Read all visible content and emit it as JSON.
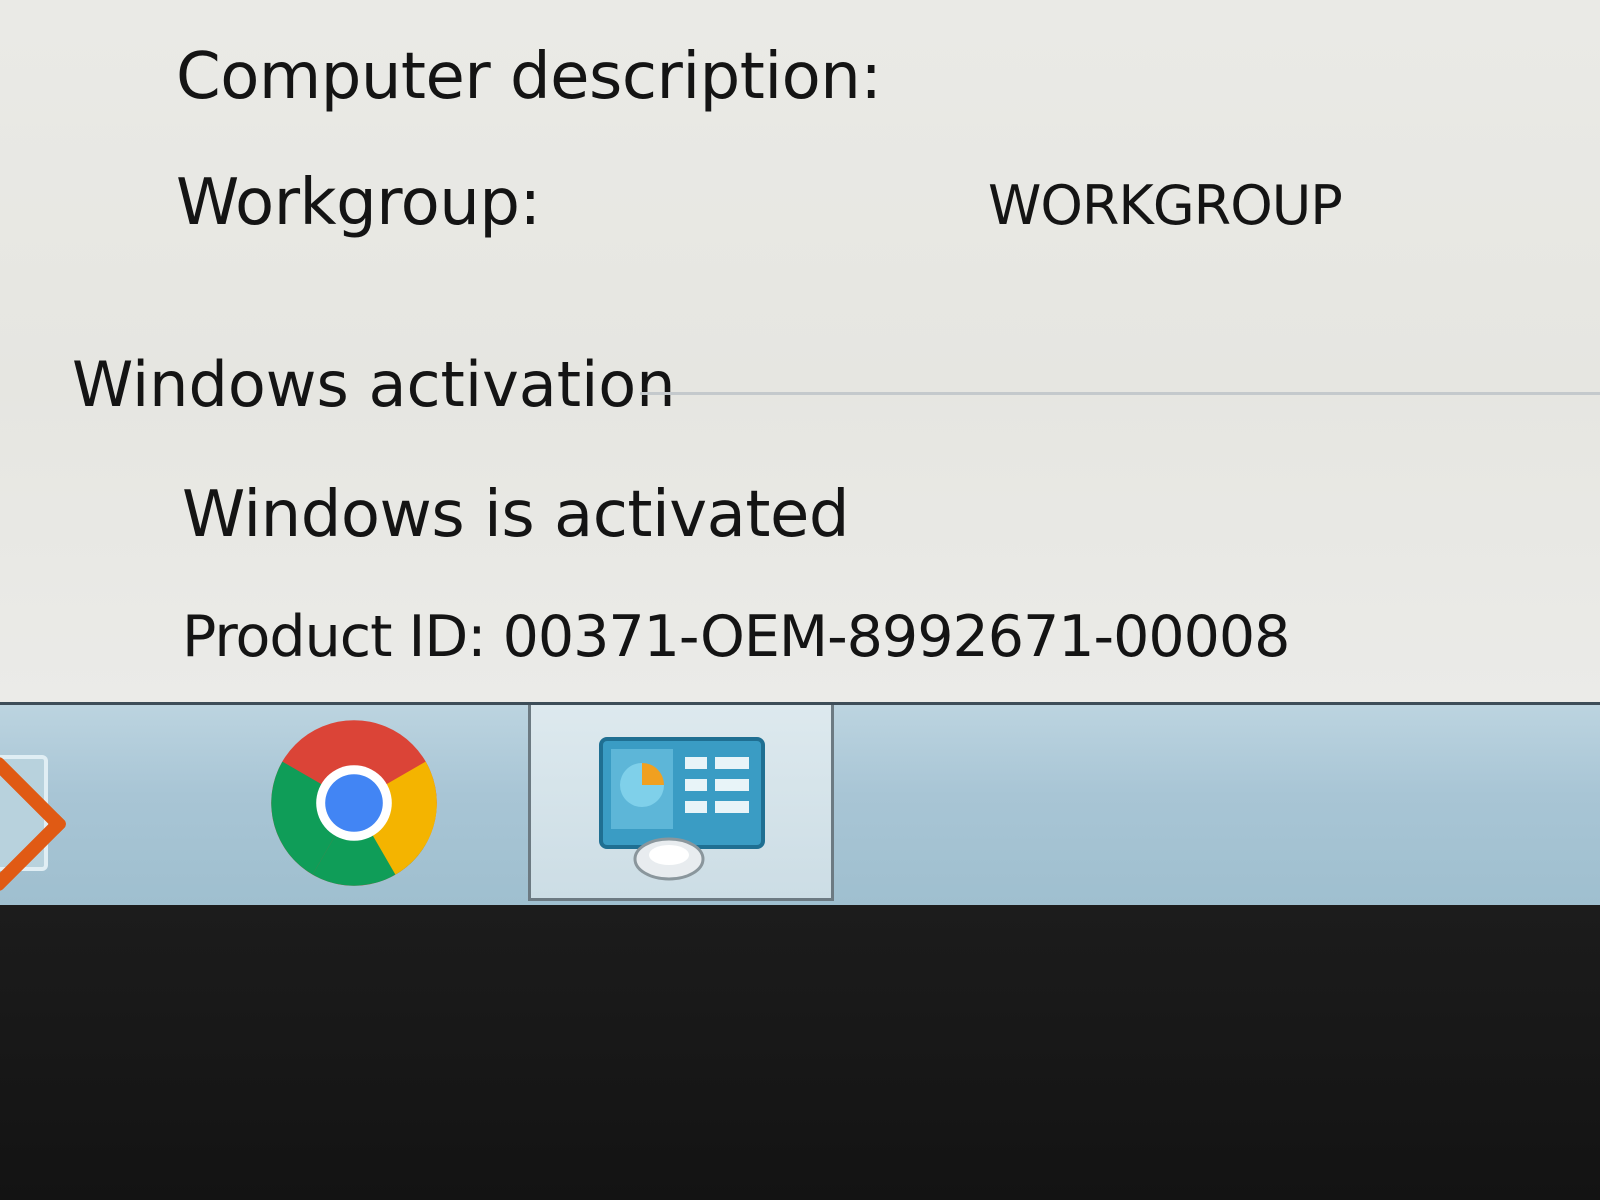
{
  "system": {
    "description_label": "Computer description:",
    "workgroup_label": "Workgroup:",
    "workgroup_value": "WORKGROUP"
  },
  "activation": {
    "section_title": "Windows activation",
    "status": "Windows is activated",
    "product_id": "Product ID: 00371-OEM-8992671-00008"
  },
  "taskbar": {
    "items": [
      {
        "icon": "media-player-icon"
      },
      {
        "icon": "chrome-icon"
      },
      {
        "icon": "control-panel-icon",
        "active": true
      }
    ]
  }
}
